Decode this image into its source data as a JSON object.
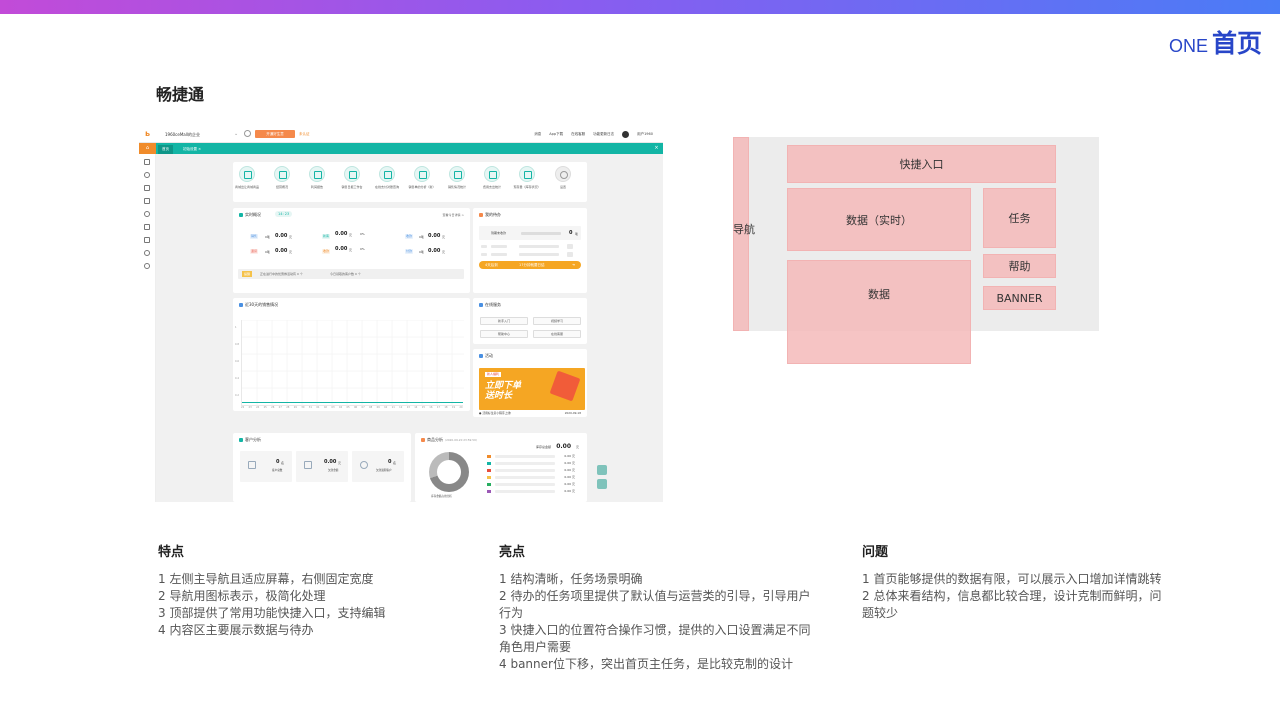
{
  "header": {
    "title_en": "ONE",
    "title_cn": "首页"
  },
  "app_name": "畅捷通",
  "screenshot": {
    "company": "1960ceMall的企业",
    "primary_button": "开通好生意",
    "verify_link": "未认证",
    "header_links": [
      "消息",
      "App下载",
      "在线客服",
      "功能更新日志",
      "用户1960"
    ],
    "tabs": [
      "首页",
      "初始设置 ×"
    ],
    "quick_entries": [
      "商城出让商城商品",
      "经营概况",
      "利润报告",
      "销售日报工作台",
      "在线支付对账查询",
      "销售单的分析（新）",
      "销售情况统计",
      "费用支出统计",
      "现存量（库存状况）",
      "设置"
    ],
    "realtime": {
      "title": "实时概况",
      "date": "14: 23",
      "more": "查看今日详情 >",
      "rows": [
        {
          "tag": "销售",
          "count": "0笔",
          "amount": "0.00",
          "unit": "元"
        },
        {
          "tag": "退货",
          "count": "0笔",
          "amount": "0.00",
          "unit": "元"
        }
      ],
      "mid": [
        {
          "tag": "新客",
          "amount": "0.00",
          "unit": "元",
          "sub": "0%"
        },
        {
          "tag": "收款",
          "amount": "0.00",
          "unit": "元",
          "sub": "0%"
        }
      ],
      "right": [
        {
          "tag": "收款",
          "count": "0笔",
          "amount": "0.00",
          "unit": "元"
        },
        {
          "tag": "付款",
          "count": "0笔",
          "amount": "0.00",
          "unit": "元"
        }
      ],
      "notice_tag": "提醒",
      "notice_1": "正在进行中的优惠券活动有 0 个",
      "notice_2": "今日领取的客户数 0 个"
    },
    "todo": {
      "title": "我的待办",
      "item": "到期未收款",
      "count": "0",
      "unit": "笔",
      "bar_left": "4天后到",
      "bar_right": "17分钟就要日结"
    },
    "sales_chart": {
      "title": "近30天的销售情况",
      "y_ticks": [
        "1",
        "0.8",
        "0.6",
        "0.4",
        "0.2",
        "0"
      ],
      "x_ticks": [
        "22",
        "23",
        "24",
        "25",
        "26",
        "27",
        "28",
        "29",
        "30",
        "31",
        "01",
        "02",
        "03",
        "04",
        "05",
        "06",
        "07",
        "08",
        "09",
        "10",
        "11",
        "12",
        "13",
        "14",
        "15",
        "16",
        "17",
        "18",
        "19",
        "20"
      ]
    },
    "service": {
      "title": "在线服务",
      "buttons": [
        "新手入门",
        "视频学习",
        "帮助中心",
        "在线客服"
      ]
    },
    "activity": {
      "title": "活动",
      "banner_tag": "新人福利",
      "banner_line1": "立即下单",
      "banner_line2": "送时长",
      "caption": "● 活用好生意小程序上线!",
      "date": "2020-09-18"
    },
    "customer": {
      "title": "客户分析",
      "stats": [
        {
          "value": "0",
          "unit": "名",
          "label": "客户总数"
        },
        {
          "value": "0.00",
          "unit": "元",
          "label": "欠款金额"
        },
        {
          "value": "0",
          "unit": "名",
          "label": "欠款逾期客户"
        }
      ]
    },
    "goods": {
      "title": "商品分析",
      "date": "(2020-09-20 23:59:59)",
      "stock_label": "库存总金额",
      "stock_value": "0.00",
      "stock_unit": "元",
      "donut_caption": "库存金额占用分析",
      "legend_values": [
        "0.00 元",
        "0.00 元",
        "0.00 元",
        "0.00 元",
        "0.00 元",
        "0.00 元"
      ],
      "legend_colors": [
        "#f08b2a",
        "#13b5a5",
        "#e74c3c",
        "#f5c24b",
        "#27ae60",
        "#9b59b6"
      ]
    }
  },
  "wireframe": {
    "nav": "导航",
    "quick_entry": "快捷入口",
    "data_realtime": "数据（实时）",
    "task": "任务",
    "help": "帮助",
    "data": "数据",
    "banner": "BANNER"
  },
  "columns": [
    {
      "title": "特点",
      "items": [
        "1 左侧主导航且适应屏幕，右侧固定宽度",
        "2 导航用图标表示，极简化处理",
        "3 顶部提供了常用功能快捷入口，支持编辑",
        "4 内容区主要展示数据与待办"
      ]
    },
    {
      "title": "亮点",
      "items": [
        "1 结构清晰，任务场景明确",
        "2 待办的任务项里提供了默认值与运营类的引导，引导用户行为",
        "3 快捷入口的位置符合操作习惯，提供的入口设置满足不同角色用户需要",
        "4 banner位下移，突出首页主任务，是比较克制的设计"
      ]
    },
    {
      "title": "问题",
      "items": [
        "1 首页能够提供的数据有限，可以展示入口增加详情跳转",
        "2 总体来看结构，信息都比较合理，设计克制而鲜明，问题较少"
      ]
    }
  ]
}
